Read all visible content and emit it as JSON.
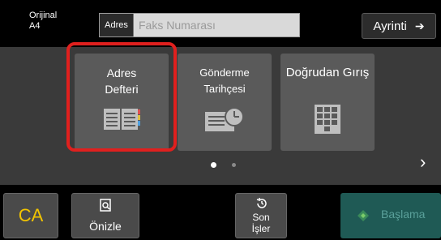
{
  "original": {
    "line1": "Orijinal",
    "line2": "A4"
  },
  "address": {
    "tag": "Adres",
    "placeholder": "Faks Numarası"
  },
  "details": {
    "label": "Ayrinti",
    "arrow": "➔"
  },
  "tiles": [
    {
      "line1": "Adres",
      "line2": "Defteri",
      "icon": "address-book-icon"
    },
    {
      "line1": "Gönderme Tarihçesi",
      "icon": "history-icon"
    },
    {
      "line1": "Doğrudan Gırış",
      "icon": "keypad-icon"
    }
  ],
  "pager": {
    "total": 2,
    "active": 1,
    "next_icon": "›"
  },
  "bottom": {
    "ca_label": "CA",
    "preview_label": "Önizle",
    "last_line1": "Son",
    "last_line2": "İşler",
    "start_label": "Başlama"
  },
  "colors": {
    "highlight": "#e0201e",
    "ca": "#f2c400",
    "start_bg": "#1f5a55",
    "start_text": "#5aa09a",
    "tile_bg": "#5a5a5a",
    "main_bg": "#3a3a3a"
  }
}
